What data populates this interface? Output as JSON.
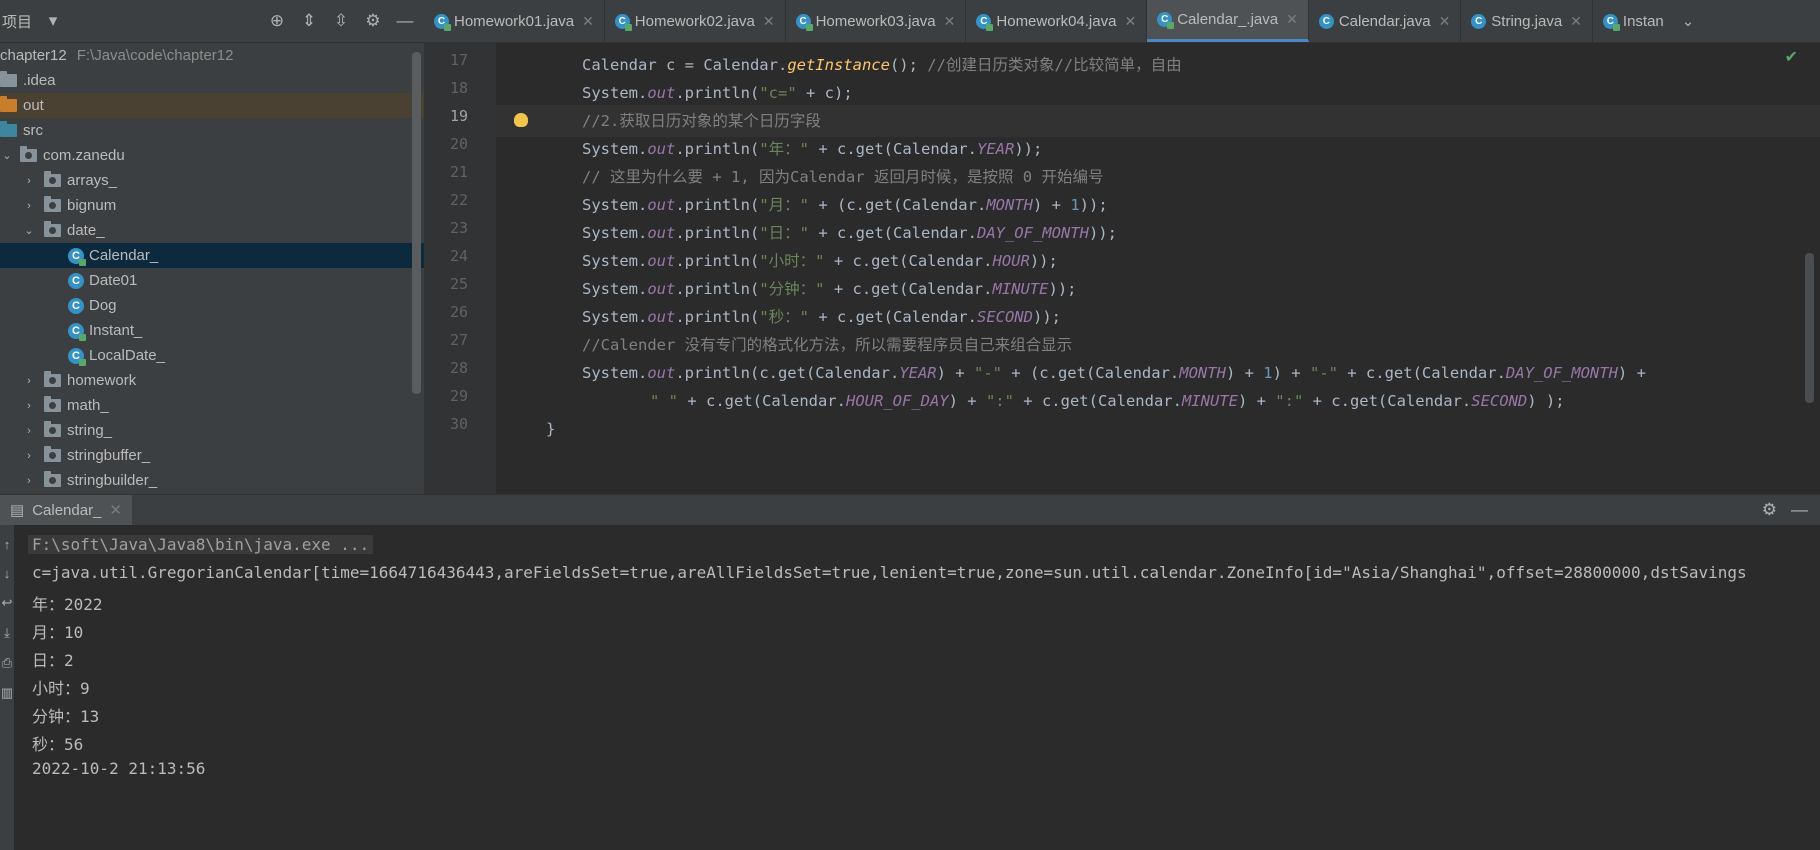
{
  "project": {
    "title": "项目",
    "root_name": "chapter12",
    "root_path": "F:\\Java\\code\\chapter12",
    "items": [
      {
        "label": "chapter12",
        "indent": 0
      },
      {
        "label": ".idea"
      },
      {
        "label": "out"
      },
      {
        "label": "src"
      },
      {
        "label": "com.zanedu"
      },
      {
        "label": "arrays_"
      },
      {
        "label": "bignum"
      },
      {
        "label": "date_"
      },
      {
        "label": "Calendar_"
      },
      {
        "label": "Date01"
      },
      {
        "label": "Dog"
      },
      {
        "label": "Instant_"
      },
      {
        "label": "LocalDate_"
      },
      {
        "label": "homework"
      },
      {
        "label": "math_"
      },
      {
        "label": "string_"
      },
      {
        "label": "stringbuffer_"
      },
      {
        "label": "stringbuilder_"
      }
    ]
  },
  "tabs": [
    {
      "label": "Homework01.java"
    },
    {
      "label": "Homework02.java"
    },
    {
      "label": "Homework03.java"
    },
    {
      "label": "Homework04.java"
    },
    {
      "label": "Calendar_.java",
      "active": true
    },
    {
      "label": "Calendar.java"
    },
    {
      "label": "String.java"
    },
    {
      "label": "Instan"
    }
  ],
  "editor": {
    "line_numbers": [
      "17",
      "18",
      "19",
      "20",
      "21",
      "22",
      "23",
      "24",
      "25",
      "26",
      "27",
      "28",
      "29",
      "30"
    ],
    "current_line": "19",
    "lines": [
      [
        [
          "Calendar c = Calendar.",
          "plain"
        ],
        [
          "getInstance",
          "sm-it"
        ],
        [
          "(); ",
          "plain"
        ],
        [
          "//创建日历类对象//比较简单，自由",
          "cm"
        ]
      ],
      [
        [
          "System.",
          "plain"
        ],
        [
          "out",
          "fld"
        ],
        [
          ".println(",
          "plain"
        ],
        [
          "\"c=\"",
          "str"
        ],
        [
          " + c);",
          "plain"
        ]
      ],
      [
        [
          "//2.获取日历对象的某个日历字段",
          "cm"
        ]
      ],
      [
        [
          "System.",
          "plain"
        ],
        [
          "out",
          "fld"
        ],
        [
          ".println(",
          "plain"
        ],
        [
          "\"年：\"",
          "str"
        ],
        [
          " + c.get(Calendar.",
          "plain"
        ],
        [
          "YEAR",
          "fld"
        ],
        [
          "));",
          "plain"
        ]
      ],
      [
        [
          "// 这里为什么要 + 1, 因为Calendar 返回月时候，是按照 0 开始编号",
          "cm"
        ]
      ],
      [
        [
          "System.",
          "plain"
        ],
        [
          "out",
          "fld"
        ],
        [
          ".println(",
          "plain"
        ],
        [
          "\"月：\"",
          "str"
        ],
        [
          " + (c.get(Calendar.",
          "plain"
        ],
        [
          "MONTH",
          "fld"
        ],
        [
          ") + ",
          "plain"
        ],
        [
          "1",
          "num"
        ],
        [
          "));",
          "plain"
        ]
      ],
      [
        [
          "System.",
          "plain"
        ],
        [
          "out",
          "fld"
        ],
        [
          ".println(",
          "plain"
        ],
        [
          "\"日：\"",
          "str"
        ],
        [
          " + c.get(Calendar.",
          "plain"
        ],
        [
          "DAY_OF_MONTH",
          "fld"
        ],
        [
          "));",
          "plain"
        ]
      ],
      [
        [
          "System.",
          "plain"
        ],
        [
          "out",
          "fld"
        ],
        [
          ".println(",
          "plain"
        ],
        [
          "\"小时：\"",
          "str"
        ],
        [
          " + c.get(Calendar.",
          "plain"
        ],
        [
          "HOUR",
          "fld"
        ],
        [
          "));",
          "plain"
        ]
      ],
      [
        [
          "System.",
          "plain"
        ],
        [
          "out",
          "fld"
        ],
        [
          ".println(",
          "plain"
        ],
        [
          "\"分钟：\"",
          "str"
        ],
        [
          " + c.get(Calendar.",
          "plain"
        ],
        [
          "MINUTE",
          "fld"
        ],
        [
          "));",
          "plain"
        ]
      ],
      [
        [
          "System.",
          "plain"
        ],
        [
          "out",
          "fld"
        ],
        [
          ".println(",
          "plain"
        ],
        [
          "\"秒：\"",
          "str"
        ],
        [
          " + c.get(Calendar.",
          "plain"
        ],
        [
          "SECOND",
          "fld"
        ],
        [
          "));",
          "plain"
        ]
      ],
      [
        [
          "//Calender 没有专门的格式化方法，所以需要程序员自己来组合显示",
          "cm"
        ]
      ],
      [
        [
          "System.",
          "plain"
        ],
        [
          "out",
          "fld"
        ],
        [
          ".println(c.get(Calendar.",
          "plain"
        ],
        [
          "YEAR",
          "fld"
        ],
        [
          ") + ",
          "plain"
        ],
        [
          "\"-\"",
          "str"
        ],
        [
          " + (c.get(Calendar.",
          "plain"
        ],
        [
          "MONTH",
          "fld"
        ],
        [
          ") + ",
          "plain"
        ],
        [
          "1",
          "num"
        ],
        [
          ") + ",
          "plain"
        ],
        [
          "\"-\"",
          "str"
        ],
        [
          " + c.get(Calendar.",
          "plain"
        ],
        [
          "DAY_OF_MONTH",
          "fld"
        ],
        [
          ") +",
          "plain"
        ]
      ],
      [
        [
          "\" \"",
          "str"
        ],
        [
          " + c.get(Calendar.",
          "plain"
        ],
        [
          "HOUR_OF_DAY",
          "fld"
        ],
        [
          ") + ",
          "plain"
        ],
        [
          "\":\"",
          "str"
        ],
        [
          " + c.get(Calendar.",
          "plain"
        ],
        [
          "MINUTE",
          "fld"
        ],
        [
          ") + ",
          "plain"
        ],
        [
          "\":\"",
          "str"
        ],
        [
          " + c.get(Calendar.",
          "plain"
        ],
        [
          "SECOND",
          "fld"
        ],
        [
          ") );",
          "plain"
        ]
      ],
      [
        [
          "}",
          "plain"
        ]
      ]
    ]
  },
  "run": {
    "tab_label": "Calendar_",
    "output": [
      "F:\\soft\\Java\\Java8\\bin\\java.exe ...",
      "c=java.util.GregorianCalendar[time=1664716436443,areFieldsSet=true,areAllFieldsSet=true,lenient=true,zone=sun.util.calendar.ZoneInfo[id=\"Asia/Shanghai\",offset=28800000,dstSavings",
      "年：2022",
      "月：10",
      "日：2",
      "小时：9",
      "分钟：13",
      "秒：56",
      "2022-10-2 21:13:56"
    ]
  }
}
